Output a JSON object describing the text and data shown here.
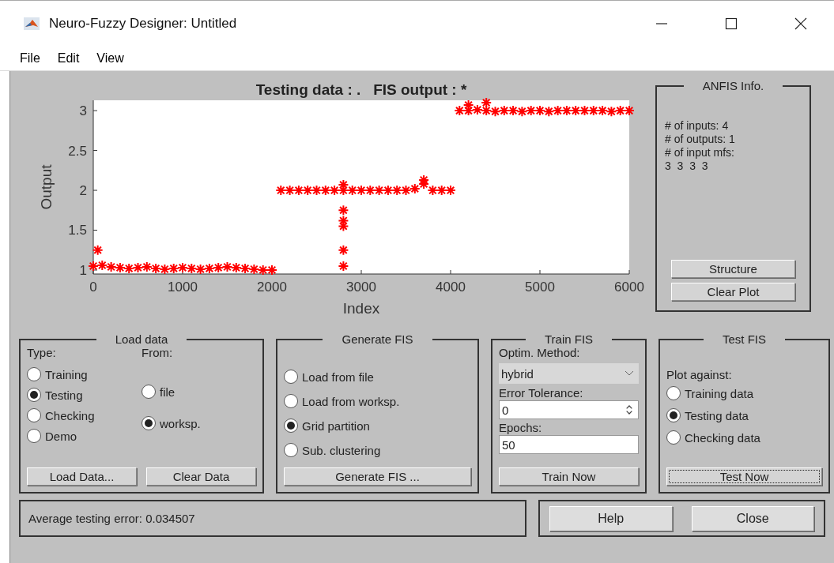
{
  "window": {
    "title": "Neuro-Fuzzy Designer: Untitled"
  },
  "menu": [
    "File",
    "Edit",
    "View"
  ],
  "plot": {
    "chart_data": {
      "type": "scatter",
      "title": "Testing data : .   FIS output : *",
      "xlabel": "Index",
      "ylabel": "Output",
      "xlim": [
        0,
        6000
      ],
      "ylim": [
        0.95,
        3.13
      ],
      "xticks": [
        0,
        1000,
        2000,
        3000,
        4000,
        5000,
        6000
      ],
      "yticks": [
        1,
        1.5,
        2,
        2.5,
        3
      ],
      "x": [
        0,
        100,
        200,
        300,
        400,
        500,
        600,
        700,
        800,
        900,
        1000,
        1100,
        1200,
        1300,
        1400,
        1500,
        1600,
        1700,
        1800,
        1900,
        2000,
        2100,
        2200,
        2300,
        2400,
        2500,
        2600,
        2700,
        2800,
        2900,
        3000,
        3100,
        3200,
        3300,
        3400,
        3500,
        3600,
        3700,
        3800,
        3900,
        4000,
        4100,
        4200,
        4300,
        4400,
        4500,
        4600,
        4700,
        4800,
        4900,
        5000,
        5100,
        5200,
        5300,
        5400,
        5500,
        5600,
        5700,
        5800,
        5900,
        6000,
        50,
        2800,
        2800,
        2800,
        2800,
        2800,
        2800,
        3700,
        4200,
        4400
      ],
      "series": [
        {
          "color": "#ff0000",
          "values": [
            1.05,
            1.06,
            1.04,
            1.03,
            1.02,
            1.03,
            1.04,
            1.02,
            1.01,
            1.02,
            1.03,
            1.02,
            1.01,
            1.02,
            1.03,
            1.04,
            1.03,
            1.02,
            1.01,
            1.0,
            1.0,
            2.0,
            2.0,
            2.0,
            2.0,
            2.0,
            2.0,
            2.0,
            2.0,
            2.0,
            2.0,
            2.0,
            2.0,
            2.0,
            2.0,
            2.0,
            2.02,
            2.08,
            2.0,
            2.0,
            2.0,
            3.0,
            3.0,
            3.01,
            3.0,
            2.99,
            3.0,
            3.0,
            2.99,
            3.0,
            3.0,
            2.99,
            3.0,
            3.0,
            3.0,
            3.0,
            3.0,
            3.0,
            2.99,
            3.0,
            3.0,
            1.25,
            1.05,
            1.25,
            1.55,
            1.62,
            1.75,
            2.07,
            2.13,
            3.07,
            3.1
          ]
        }
      ]
    }
  },
  "anfis_info": {
    "title": "ANFIS Info.",
    "lines": [
      "# of inputs: 4",
      "# of outputs: 1",
      "# of input mfs:",
      "3  3  3  3"
    ],
    "buttons": [
      "Structure",
      "Clear Plot"
    ]
  },
  "load_data": {
    "title": "Load data",
    "type_label": "Type:",
    "from_label": "From:",
    "types": [
      {
        "label": "Training",
        "selected": false
      },
      {
        "label": "Testing",
        "selected": true
      },
      {
        "label": "Checking",
        "selected": false
      },
      {
        "label": "Demo",
        "selected": false
      }
    ],
    "sources": [
      {
        "label": "file",
        "selected": false
      },
      {
        "label": "worksp.",
        "selected": true
      }
    ],
    "buttons": [
      "Load Data...",
      "Clear Data"
    ]
  },
  "generate_fis": {
    "title": "Generate FIS",
    "options": [
      {
        "label": "Load from file",
        "selected": false
      },
      {
        "label": "Load from worksp.",
        "selected": false
      },
      {
        "label": "Grid partition",
        "selected": true
      },
      {
        "label": "Sub. clustering",
        "selected": false
      }
    ],
    "button": "Generate FIS ..."
  },
  "train_fis": {
    "title": "Train FIS",
    "method_label": "Optim. Method:",
    "method": "hybrid",
    "tolerance_label": "Error Tolerance:",
    "tolerance": "0",
    "epochs_label": "Epochs:",
    "epochs": "50",
    "button": "Train Now"
  },
  "test_fis": {
    "title": "Test FIS",
    "plot_against_label": "Plot against:",
    "options": [
      {
        "label": "Training data",
        "selected": false
      },
      {
        "label": "Testing data",
        "selected": true
      },
      {
        "label": "Checking data",
        "selected": false
      }
    ],
    "button": "Test Now",
    "focused": true
  },
  "status": "Average testing error: 0.034507",
  "buttons": [
    "Help",
    "Close"
  ]
}
